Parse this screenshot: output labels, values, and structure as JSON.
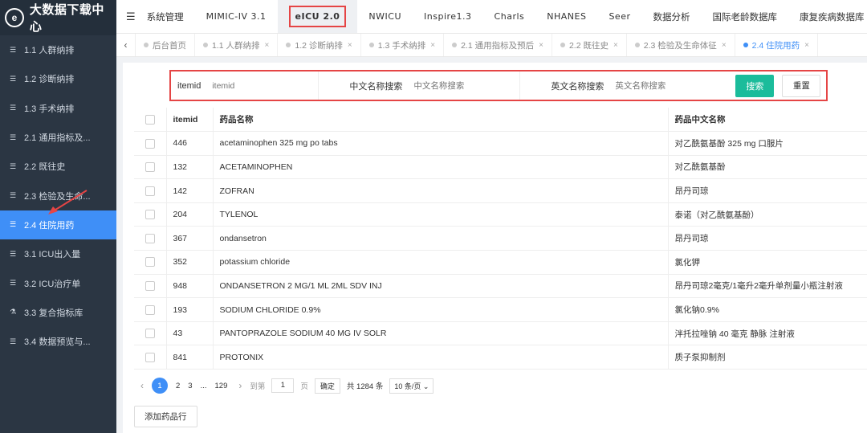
{
  "brand": {
    "logo": "e",
    "title": "大数据下载中心"
  },
  "sidebar": {
    "items": [
      {
        "icon": "list-icon",
        "label": "1.1 人群纳排",
        "active": false
      },
      {
        "icon": "list-icon",
        "label": "1.2 诊断纳排",
        "active": false
      },
      {
        "icon": "list-icon",
        "label": "1.3 手术纳排",
        "active": false
      },
      {
        "icon": "list-icon",
        "label": "2.1 通用指标及...",
        "active": false
      },
      {
        "icon": "list-icon",
        "label": "2.2 既往史",
        "active": false
      },
      {
        "icon": "list-icon",
        "label": "2.3 检验及生命...",
        "active": false
      },
      {
        "icon": "list-icon",
        "label": "2.4 住院用药",
        "active": true
      },
      {
        "icon": "list-icon",
        "label": "3.1 ICU出入量",
        "active": false
      },
      {
        "icon": "list-icon",
        "label": "3.2 ICU治疗单",
        "active": false
      },
      {
        "icon": "flask-icon",
        "label": "3.3 复合指标库",
        "active": false
      },
      {
        "icon": "list-icon",
        "label": "3.4 数据预览与...",
        "active": false
      }
    ]
  },
  "topnav": {
    "items": [
      "系统管理",
      "MIMIC-IV 3.1",
      "eICU 2.0",
      "NWICU",
      "Inspire1.3",
      "Charls",
      "NHANES",
      "Seer",
      "数据分析",
      "国际老龄数据库",
      "康复疾病数据库"
    ],
    "active": "eICU 2.0"
  },
  "tabs": {
    "items": [
      {
        "label": "后台首页",
        "closable": false,
        "active": false
      },
      {
        "label": "1.1 人群纳排",
        "closable": true,
        "active": false
      },
      {
        "label": "1.2 诊断纳排",
        "closable": true,
        "active": false
      },
      {
        "label": "1.3 手术纳排",
        "closable": true,
        "active": false
      },
      {
        "label": "2.1 通用指标及预后",
        "closable": true,
        "active": false
      },
      {
        "label": "2.2 既往史",
        "closable": true,
        "active": false
      },
      {
        "label": "2.3 检验及生命体征",
        "closable": true,
        "active": false
      },
      {
        "label": "2.4 住院用药",
        "closable": true,
        "active": true
      }
    ]
  },
  "search": {
    "itemid_label": "itemid",
    "itemid_placeholder": "itemid",
    "cn_label": "中文名称搜索",
    "cn_placeholder": "中文名称搜索",
    "en_label": "英文名称搜索",
    "en_placeholder": "英文名称搜索",
    "search_btn": "搜索",
    "reset_btn": "重置"
  },
  "table": {
    "headers": [
      "itemid",
      "药品名称",
      "药品中文名称"
    ],
    "rows": [
      [
        "446",
        "acetaminophen 325 mg po tabs",
        "对乙酰氨基酚 325 mg 口服片"
      ],
      [
        "132",
        "ACETAMINOPHEN",
        "对乙酰氨基酚"
      ],
      [
        "142",
        "ZOFRAN",
        "昂丹司琼"
      ],
      [
        "204",
        "TYLENOL",
        "泰诺（对乙酰氨基酚）"
      ],
      [
        "367",
        "ondansetron",
        "昂丹司琼"
      ],
      [
        "352",
        "potassium chloride",
        "氯化钾"
      ],
      [
        "948",
        "ONDANSETRON 2 MG/1 ML 2ML SDV INJ",
        "昂丹司琼2毫克/1毫升2毫升单剂量小瓶注射液"
      ],
      [
        "193",
        "SODIUM CHLORIDE 0.9%",
        "氯化钠0.9%"
      ],
      [
        "43",
        "PANTOPRAZOLE SODIUM 40 MG IV SOLR",
        "泮托拉唑钠 40 毫克 静脉 注射液"
      ],
      [
        "841",
        "PROTONIX",
        "质子泵抑制剂"
      ]
    ]
  },
  "pager": {
    "prev": "‹",
    "pages": [
      "1",
      "2",
      "3",
      "...",
      "129"
    ],
    "current": "1",
    "next": "›",
    "goto_label": "到第",
    "goto_value": "1",
    "page_unit": "页",
    "confirm": "确定",
    "total": "共 1284 条",
    "page_size": "10 条/页"
  },
  "add_button": "添加药品行"
}
